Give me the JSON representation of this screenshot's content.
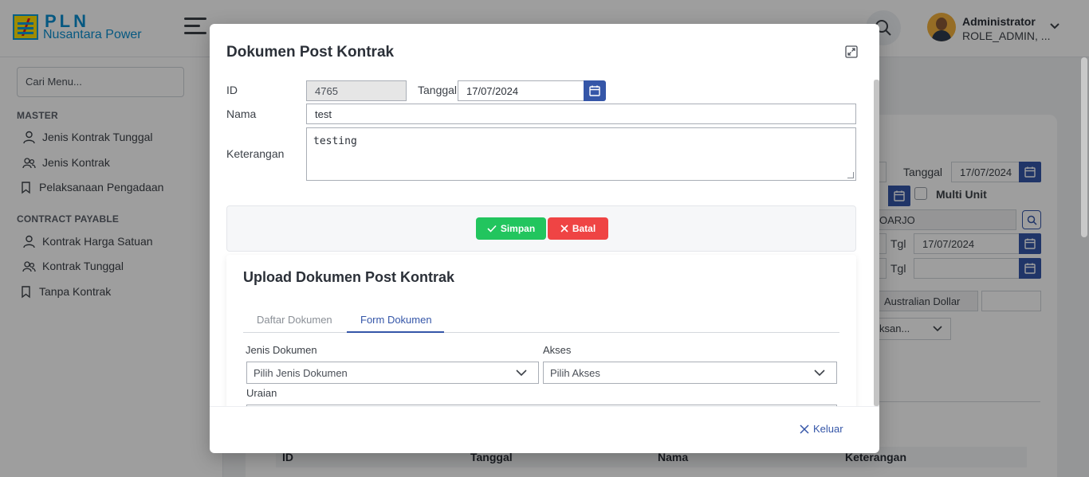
{
  "app": {
    "logo_title": "PLN",
    "logo_subtitle": "Nusantara Power"
  },
  "user": {
    "name": "Administrator",
    "role": "ROLE_ADMIN, ..."
  },
  "sidebar": {
    "search_placeholder": "Cari Menu...",
    "sections": [
      {
        "title": "MASTER",
        "items": [
          {
            "label": "Jenis Kontrak Tunggal",
            "icon": "user-icon"
          },
          {
            "label": "Jenis Kontrak",
            "icon": "users-icon"
          },
          {
            "label": "Pelaksanaan Pengadaan",
            "icon": "bookmark-icon"
          }
        ]
      },
      {
        "title": "CONTRACT PAYABLE",
        "items": [
          {
            "label": "Kontrak Harga Satuan",
            "icon": "user-icon"
          },
          {
            "label": "Kontrak Tunggal",
            "icon": "users-icon"
          },
          {
            "label": "Tanpa Kontrak",
            "icon": "bookmark-icon"
          }
        ]
      }
    ]
  },
  "background_form": {
    "tanggal_label": "Tanggal",
    "tanggal_value": "17/07/2024",
    "multi_unit_label": "Multi Unit",
    "unit_value": "OARJO",
    "tgl_label_1": "Tgl",
    "tgl_value_1": "17/07/2024",
    "tgl_label_2": "Tgl",
    "tgl_value_2": "",
    "currency_value": "Australian Dollar",
    "select_partial": "ksan...",
    "table_headers": [
      "ID",
      "Tanggal",
      "Nama",
      "Keterangan"
    ]
  },
  "modal": {
    "title": "Dokumen Post Kontrak",
    "id_label": "ID",
    "id_value": "4765",
    "tanggal_label": "Tanggal",
    "tanggal_value": "17/07/2024",
    "nama_label": "Nama",
    "nama_value": "test",
    "keterangan_label": "Keterangan",
    "keterangan_value": "testing",
    "save_label": "Simpan",
    "cancel_label": "Batal",
    "exit_label": "Keluar"
  },
  "upload": {
    "title": "Upload Dokumen Post Kontrak",
    "tabs": [
      {
        "label": "Daftar Dokumen",
        "active": false
      },
      {
        "label": "Form Dokumen",
        "active": true
      }
    ],
    "jenis_label": "Jenis Dokumen",
    "jenis_placeholder": "Pilih Jenis Dokumen",
    "akses_label": "Akses",
    "akses_placeholder": "Pilih Akses",
    "uraian_label": "Uraian"
  },
  "colors": {
    "primary": "#3556a8",
    "save": "#22c55e",
    "cancel": "#ef4444",
    "brand": "#0a8fd0"
  }
}
